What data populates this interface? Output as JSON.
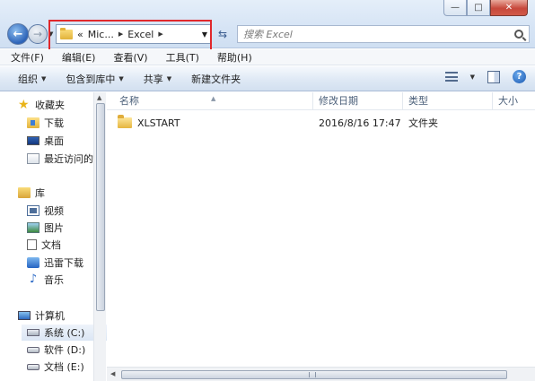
{
  "window": {
    "minimize_glyph": "—",
    "maximize_glyph": "□",
    "close_glyph": "✕"
  },
  "nav": {
    "back_glyph": "←",
    "forward_glyph": "→",
    "dropdown_glyph": "▼",
    "refresh_glyph": "⇆"
  },
  "address": {
    "prefix": "«",
    "crumbs": [
      "Mic...",
      "Excel"
    ],
    "separator": "▶",
    "dropdown_glyph": "▼"
  },
  "search": {
    "placeholder": "搜索 Excel"
  },
  "menu": {
    "items": [
      "文件(F)",
      "编辑(E)",
      "查看(V)",
      "工具(T)",
      "帮助(H)"
    ]
  },
  "toolbar": {
    "organize": "组织",
    "include_in_library": "包含到库中",
    "share": "共享",
    "new_folder": "新建文件夹",
    "caret": "▼",
    "help_glyph": "?"
  },
  "sidebar": {
    "favorites": {
      "label": "收藏夹",
      "items": [
        "下载",
        "桌面",
        "最近访问的位"
      ]
    },
    "libraries": {
      "label": "库",
      "items": [
        "视频",
        "图片",
        "文档",
        "迅雷下载",
        "音乐"
      ]
    },
    "computer": {
      "label": "计算机",
      "items": [
        "系统 (C:)",
        "软件 (D:)",
        "文档 (E:)"
      ]
    },
    "scroll_up_glyph": "▲"
  },
  "content": {
    "columns": [
      "名称",
      "修改日期",
      "类型",
      "大小"
    ],
    "sort_caret": "▲",
    "rows": [
      {
        "name": "XLSTART",
        "modified": "2016/8/16 17:47",
        "type": "文件夹"
      }
    ]
  },
  "hscroll": {
    "left_glyph": "◀"
  }
}
